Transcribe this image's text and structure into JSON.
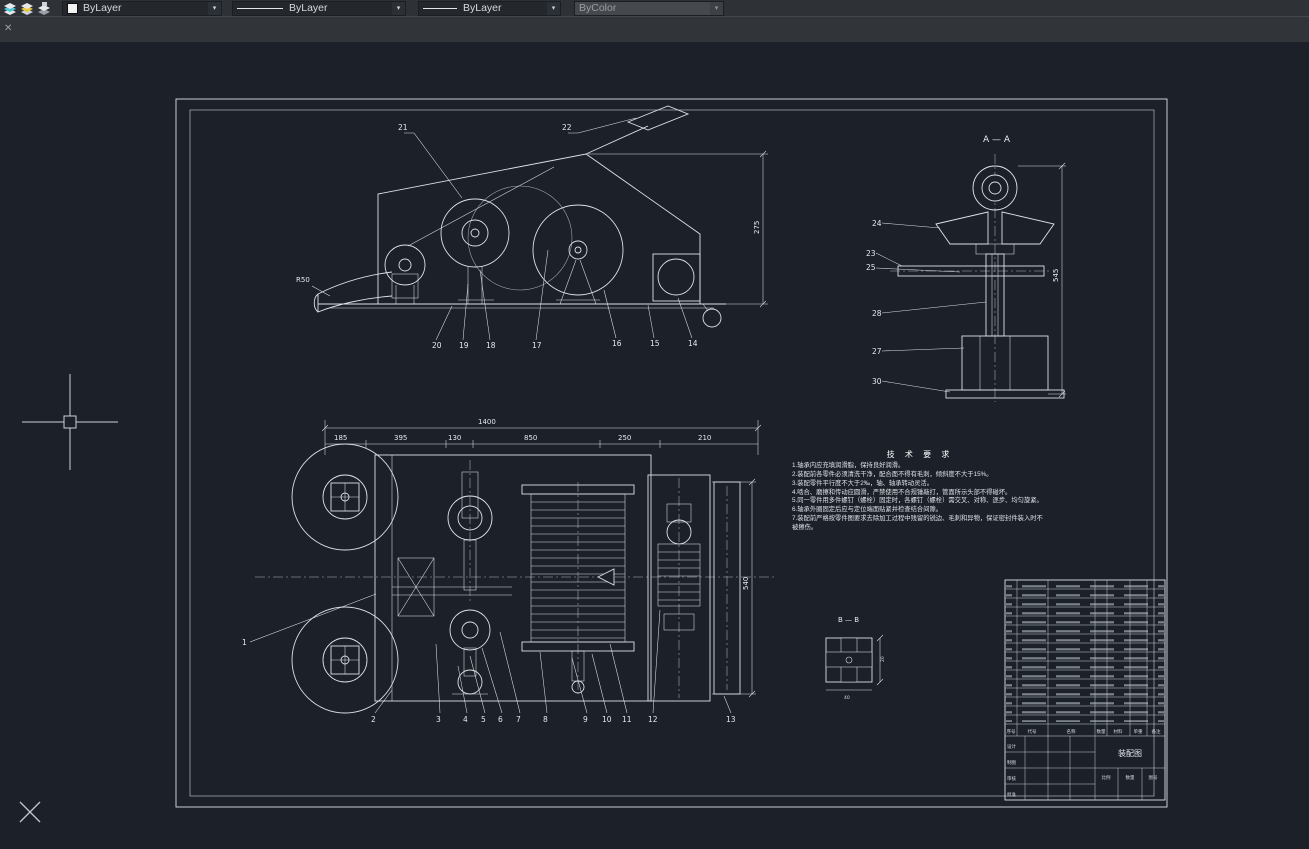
{
  "icons": {
    "chevron_down": "▾",
    "close": "✕"
  },
  "colors": {
    "accent_cyan": "#49c8dc",
    "accent_yellow": "#e8c53a",
    "swatch_white": "#f2f2f2"
  },
  "toolbar": {
    "color_value": "ByLayer",
    "linetype_value": "ByLayer",
    "lineweight_value": "ByLayer",
    "plotstyle_value": "ByColor"
  },
  "drawing": {
    "elevation": {
      "balloons_top": [
        "21",
        "22"
      ],
      "balloons_bottom": [
        "20",
        "19",
        "18",
        "17",
        "16",
        "15",
        "14"
      ],
      "dim_right": "275",
      "dim_left": "R50"
    },
    "section_aa": {
      "label": "A — A",
      "balloons": [
        "24",
        "23",
        "25",
        "28",
        "27",
        "30"
      ],
      "dim_right": "545"
    },
    "plan": {
      "dim_total": "1400",
      "dims": [
        "185",
        "395",
        "130",
        "850",
        "250",
        "210"
      ],
      "dim_right": "540",
      "balloon_left": "1",
      "balloons_bottom": [
        "2",
        "3",
        "4",
        "5",
        "6",
        "7",
        "8",
        "9",
        "10",
        "11",
        "12",
        "13"
      ]
    },
    "section_bb": {
      "label": "B — B",
      "dim_side": "20",
      "dim_bottom": "40"
    },
    "tech_notes": {
      "title": "技 术 要 求",
      "lines": [
        "1.轴承内应充填润滑脂，保持良好润滑。",
        "2.装配前各零件必须清洗干净，配合面不得有毛刺，倾斜度不大于15%。",
        "3.装配零件平行度不大于2‰，轴、轴承转动灵活。",
        "4.啮合、磨擦和传动应圆滑，严禁使用不合规锤敲打，管面所示头部不得碰坏。",
        "5.同一零件用多件螺钉（螺栓）固定时，各螺钉（螺栓）需交叉、对称、逐步、均匀旋紧。",
        "6.轴承外圈固定后应与定位端面贴紧并检查结合间隙。",
        "7.装配前严格按零件图要求去除加工过程中残留的锐边、毛刺和异物，保证密封件装入时不被擦伤。"
      ]
    },
    "parts_table": {
      "headers": [
        "序号",
        "代号",
        "名称",
        "数量",
        "材料",
        "单重",
        "备注"
      ],
      "signatures": [
        "设计",
        "制图",
        "审核",
        "批准"
      ],
      "title": "装配图",
      "fields": [
        "比例",
        "数量",
        "图号"
      ]
    }
  }
}
